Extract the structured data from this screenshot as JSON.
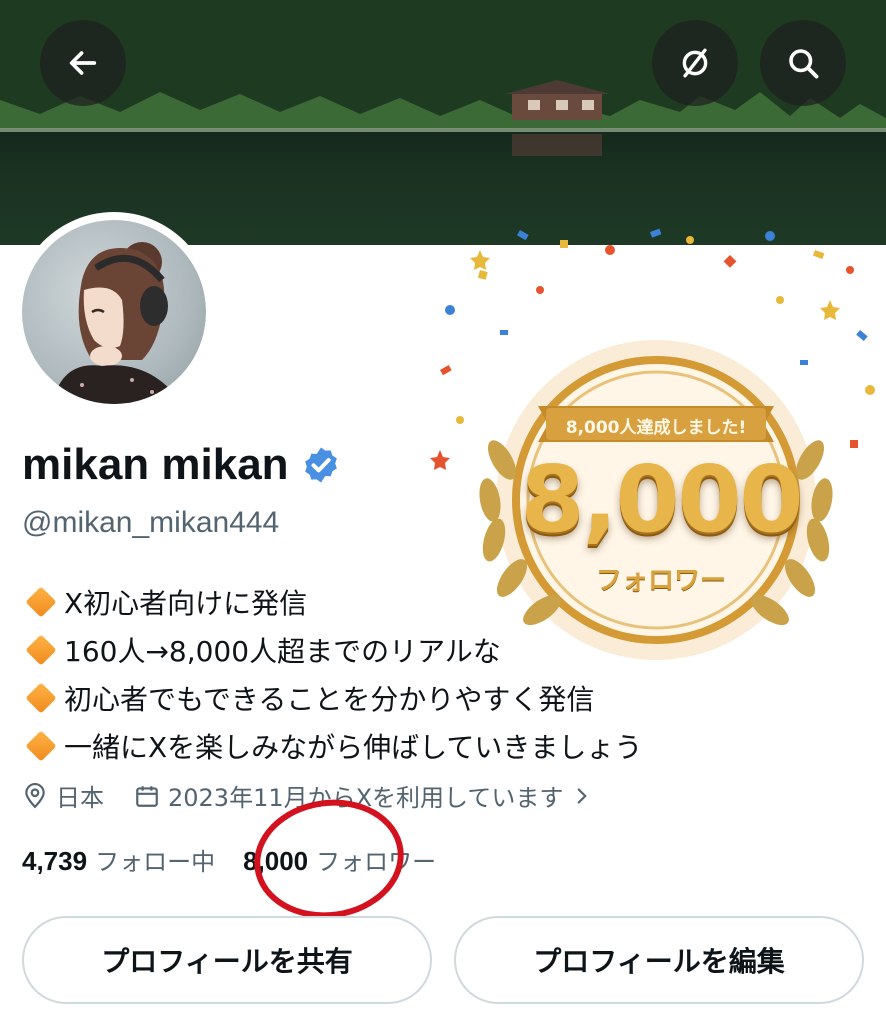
{
  "header": {
    "back_icon": "arrow-left-icon",
    "grok_icon": "slash-circle-icon",
    "search_icon": "search-icon"
  },
  "profile": {
    "display_name": "mikan mikan",
    "handle": "@mikan_mikan444",
    "verified": true,
    "verified_color": "#4a90e2"
  },
  "bio": {
    "lines": [
      "X初心者向けに発信",
      "160人→8,000人超までのリアルな",
      "初心者でもできることを分かりやすく発信",
      "一緒にXを楽しみながら伸ばしていきましょう"
    ],
    "bullet_color": "#f39a2b"
  },
  "meta": {
    "location": "日本",
    "joined": "2023年11月からXを利用しています"
  },
  "stats": {
    "following_count": "4,739",
    "following_label": "フォロー中",
    "followers_count": "8,000",
    "followers_label": "フォロワー",
    "highlight_color": "#d3121f"
  },
  "badge": {
    "ribbon_text": "8,000人達成しました!",
    "big_number": "8,000",
    "sub_text": "フォロワー"
  },
  "buttons": {
    "share": "プロフィールを共有",
    "edit": "プロフィールを編集"
  }
}
